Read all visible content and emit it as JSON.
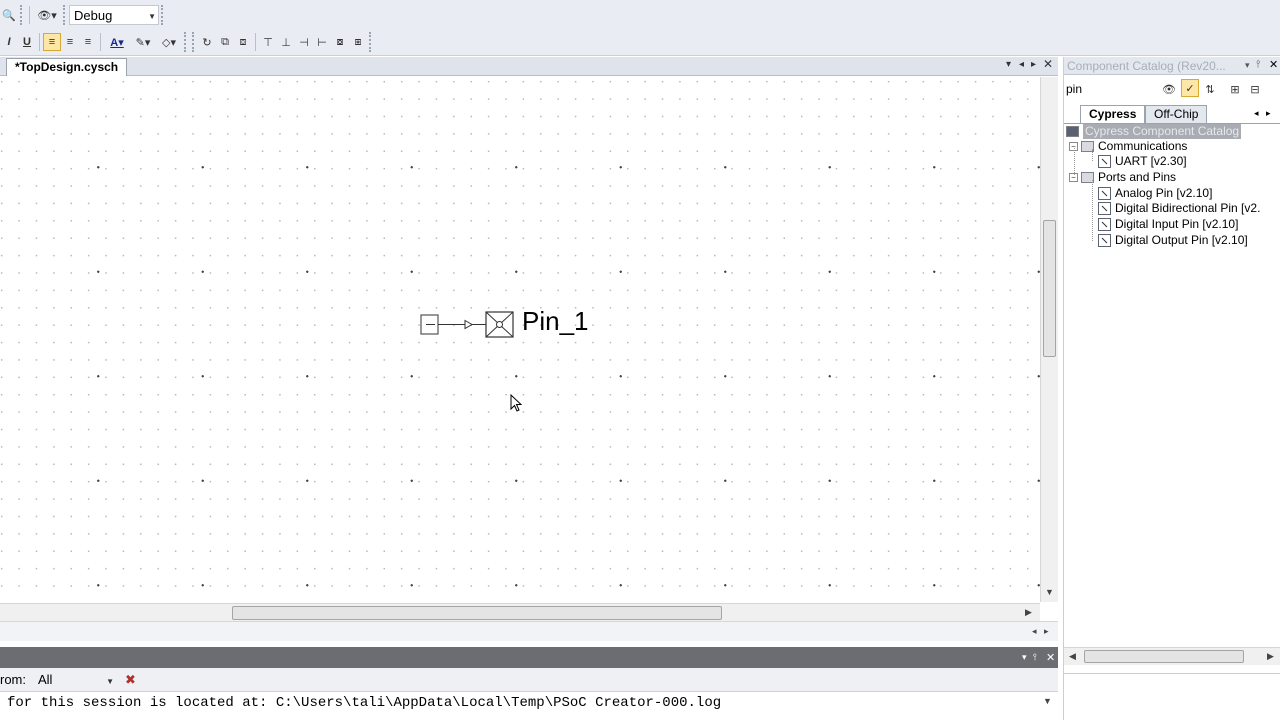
{
  "toolbar": {
    "config_combo_value": "Debug"
  },
  "document": {
    "tab_label": "*TopDesign.cysch"
  },
  "schematic": {
    "component_label": "Pin_1"
  },
  "output": {
    "filter_label": "rom:",
    "filter_value": "All",
    "log_text": "for this session is located at: C:\\Users\\tali\\AppData\\Local\\Temp\\PSoC Creator-000.log"
  },
  "catalog": {
    "title": "Component Catalog (Rev20...",
    "search_value": "pin",
    "tabs": [
      "Cypress",
      "Off-Chip"
    ],
    "root": "Cypress Component Catalog",
    "groups": [
      {
        "label": "Communications",
        "items": [
          "UART [v2.30]"
        ]
      },
      {
        "label": "Ports and Pins",
        "items": [
          "Analog Pin [v2.10]",
          "Digital Bidirectional Pin [v2.",
          "Digital Input Pin [v2.10]",
          "Digital Output Pin [v2.10]"
        ]
      }
    ]
  },
  "colors": {
    "toolbar_bg": "#e9edf3",
    "selected_root_bg": "#a9acb3",
    "output_title_bg": "#6b6d72"
  },
  "icons": [
    "zoom-icon",
    "find-icon",
    "bold-icon",
    "underline-icon",
    "align-left-icon",
    "align-center-icon",
    "align-right-icon",
    "font-color-icon",
    "highlight-icon",
    "fill-icon",
    "close-icon",
    "pin-icon",
    "clear-icon",
    "sort-icon",
    "filter-icon"
  ]
}
